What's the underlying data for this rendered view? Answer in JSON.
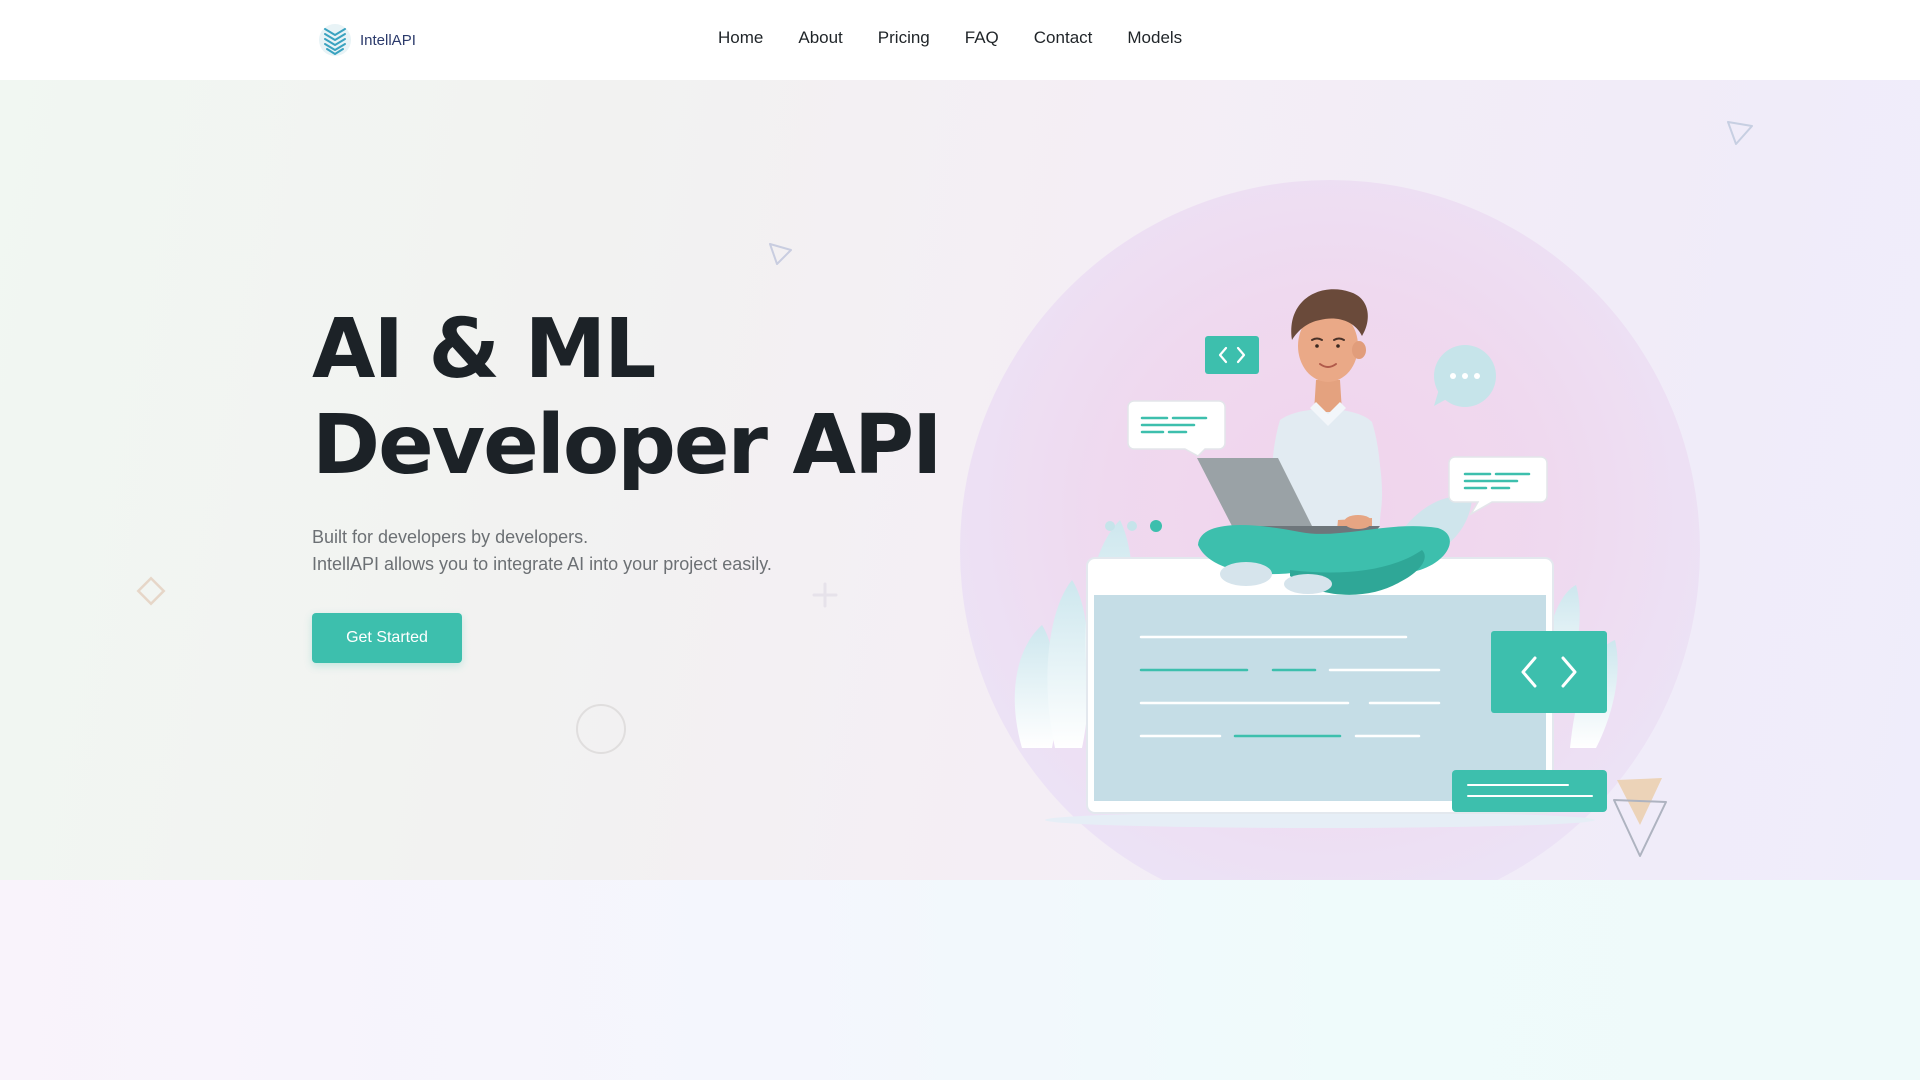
{
  "brand": {
    "name": "IntellAPI"
  },
  "nav": {
    "items": [
      {
        "label": "Home"
      },
      {
        "label": "About"
      },
      {
        "label": "Pricing"
      },
      {
        "label": "FAQ"
      },
      {
        "label": "Contact"
      },
      {
        "label": "Models"
      }
    ]
  },
  "hero": {
    "title_line1": "AI & ML",
    "title_line2": "Developer API",
    "subtitle_line1": "Built for developers by developers.",
    "subtitle_line2": "IntellAPI allows you to integrate AI into your project easily.",
    "cta_label": "Get Started"
  },
  "colors": {
    "accent": "#3dbfad",
    "heading": "#1c2227",
    "body_text": "#6c7074",
    "brand_text": "#2b3a6b"
  },
  "icons": {
    "logo": "layered-chevron-logo",
    "code": "code-brackets-icon",
    "chat": "chat-bubble-icon"
  }
}
